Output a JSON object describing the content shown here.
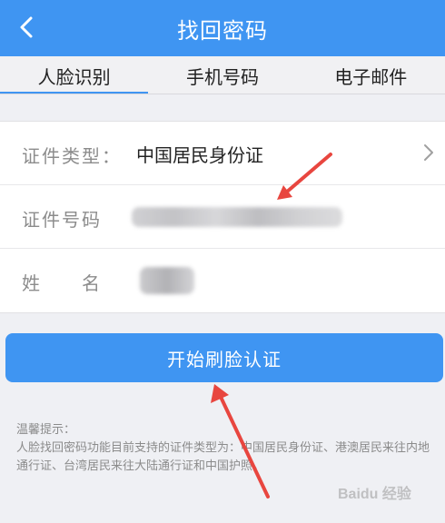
{
  "header": {
    "back_icon": "chevron-left-icon",
    "title": "找回密码"
  },
  "tabs": [
    {
      "label": "人脸识别",
      "active": true
    },
    {
      "label": "手机号码",
      "active": false
    },
    {
      "label": "电子邮件",
      "active": false
    }
  ],
  "form": {
    "id_type": {
      "label": "证件类型：",
      "value": "中国居民身份证",
      "icon": "chevron-right-icon"
    },
    "id_number": {
      "label": "证件号码",
      "value": ""
    },
    "name": {
      "label": "姓　　名",
      "value": ""
    }
  },
  "button": {
    "label": "开始刷脸认证"
  },
  "tips": {
    "title": "温馨提示：",
    "text": "人脸找回密码功能目前支持的证件类型为：中国居民身份证、港澳居民来往内地通行证、台湾居民来往大陆通行证和中国护照。"
  },
  "watermark": {
    "text": "Baidu 经验"
  },
  "colors": {
    "primary": "#3f95f2",
    "annotation_arrow": "#e8463f"
  }
}
